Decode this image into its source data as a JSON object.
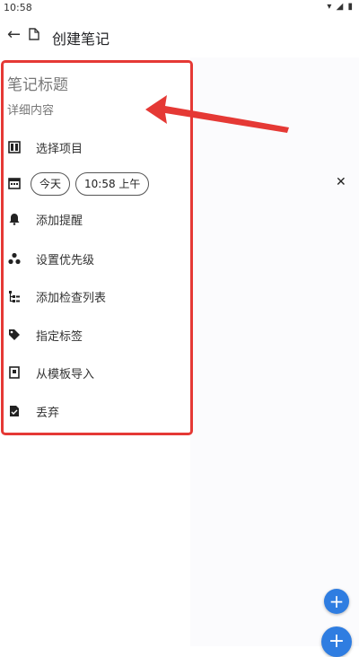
{
  "status_bar": {
    "time": "10:58",
    "icons": "▾ ◢ ▮"
  },
  "top_bar": {
    "title": "创建笔记"
  },
  "note": {
    "title_placeholder": "笔记标题",
    "detail_placeholder": "详细内容"
  },
  "menu": {
    "select_project": "选择项目",
    "date_chip": "今天",
    "time_chip": "10:58 上午",
    "add_reminder": "添加提醒",
    "set_priority": "设置优先级",
    "add_checklist": "添加检查列表",
    "assign_tag": "指定标签",
    "import_template": "从模板导入",
    "discard": "丢弃"
  },
  "fab": {
    "plus_label": "+"
  },
  "colors": {
    "highlight": "#e53935",
    "fab": "#2f7de1"
  }
}
